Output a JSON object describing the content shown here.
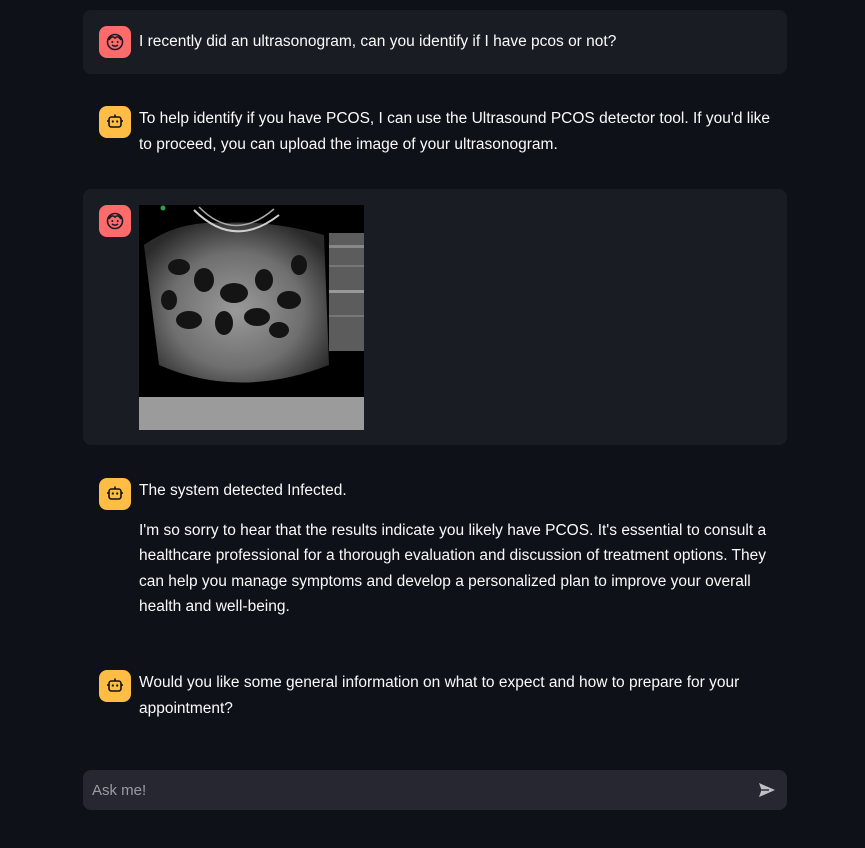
{
  "messages": [
    {
      "role": "user",
      "text": "I recently did an ultrasonogram, can you identify if I have pcos or not?"
    },
    {
      "role": "assistant",
      "text": "To help identify if you have PCOS, I can use the Ultrasound PCOS detector tool. If you'd like to proceed, you can upload the image of your ultrasonogram."
    },
    {
      "role": "user",
      "attachment": "ultrasound-image"
    },
    {
      "role": "assistant",
      "paragraphs": [
        "The system detected Infected.",
        "I'm so sorry to hear that the results indicate you likely have PCOS. It's essential to consult a healthcare professional for a thorough evaluation and discussion of treatment options. They can help you manage symptoms and develop a personalized plan to improve your overall health and well-being."
      ]
    },
    {
      "role": "assistant",
      "text": "Would you like some general information on what to expect and how to prepare for your appointment?"
    }
  ],
  "chat_input": {
    "placeholder": "Ask me!",
    "value": ""
  },
  "icons": {
    "user_avatar": "smiling-face-icon",
    "assistant_avatar": "robot-face-icon",
    "send": "send-arrow-icon"
  },
  "colors": {
    "background": "#0e1117",
    "user_bubble": "#1a1c24",
    "user_avatar": "#ff6b6b",
    "assistant_avatar": "#ffbd45",
    "input_bg": "#262730"
  }
}
